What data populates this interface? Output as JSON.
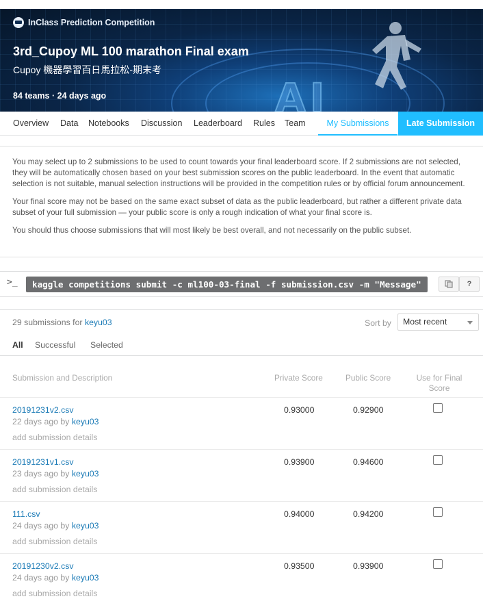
{
  "banner": {
    "competition_type": "InClass Prediction Competition",
    "title": "3rd_Cupoy ML 100 marathon Final exam",
    "subtitle": "Cupoy 機器學習百日馬拉松-期末考",
    "teams": "84 teams",
    "separator": " · ",
    "age": "24 days ago",
    "ai_text": "AI"
  },
  "tabs": [
    "Overview",
    "Data",
    "Notebooks",
    "Discussion",
    "Leaderboard",
    "Rules",
    "Team",
    "My Submissions"
  ],
  "late_submission_label": "Late Submission",
  "info": {
    "p1": "You may select up to 2 submissions to be used to count towards your final leaderboard score. If 2 submissions are not selected, they will be automatically chosen based on your best submission scores on the public leaderboard. In the event that automatic selection is not suitable, manual selection instructions will be provided in the competition rules or by official forum announcement.",
    "p2": "Your final score may not be based on the same exact subset of data as the public leaderboard, but rather a different private data subset of your full submission — your public score is only a rough indication of what your final score is.",
    "p3": "You should thus choose submissions that will most likely be best overall, and not necessarily on the public subset."
  },
  "command": {
    "prompt": ">_",
    "text": "kaggle competitions submit -c ml100-03-final -f submission.csv -m \"Message\"",
    "help_label": "?"
  },
  "submissions": {
    "count_text": "29 submissions for ",
    "user": "keyu03",
    "sort_label": "Sort by",
    "sort_value": "Most recent",
    "filters": [
      "All",
      "Successful",
      "Selected"
    ],
    "columns": {
      "description": "Submission and Description",
      "private": "Private Score",
      "public": "Public Score",
      "final": "Use for Final Score"
    },
    "rows": [
      {
        "file": "20191231v2.csv",
        "age": "22 days ago by ",
        "user": "keyu03",
        "details": "add submission details",
        "private": "0.93000",
        "public": "0.92900"
      },
      {
        "file": "20191231v1.csv",
        "age": "23 days ago by ",
        "user": "keyu03",
        "details": "add submission details",
        "private": "0.93900",
        "public": "0.94600"
      },
      {
        "file": "111.csv",
        "age": "24 days ago by ",
        "user": "keyu03",
        "details": "add submission details",
        "private": "0.94000",
        "public": "0.94200"
      },
      {
        "file": "20191230v2.csv",
        "age": "24 days ago by ",
        "user": "keyu03",
        "details": "add submission details",
        "private": "0.93500",
        "public": "0.93900"
      }
    ]
  },
  "colors": {
    "accent": "#20beff",
    "link": "#1a7ab6",
    "banner_dark": "#0a2547"
  }
}
